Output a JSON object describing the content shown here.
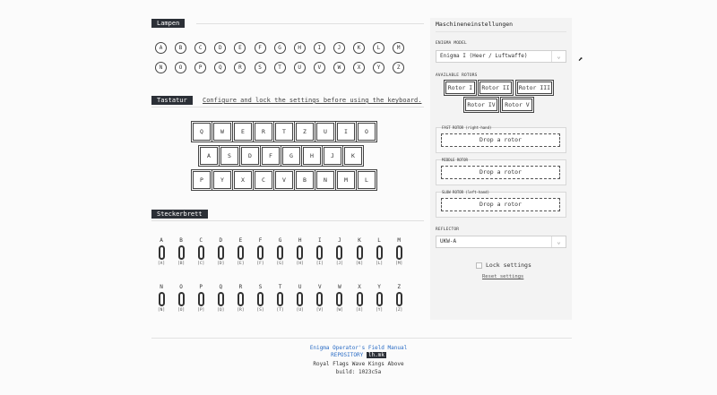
{
  "lampboard": {
    "title": "Lampen",
    "row1": [
      "A",
      "B",
      "C",
      "D",
      "E",
      "F",
      "G",
      "H",
      "I",
      "J",
      "K",
      "L",
      "M"
    ],
    "row2": [
      "N",
      "O",
      "P",
      "Q",
      "R",
      "S",
      "T",
      "U",
      "V",
      "W",
      "X",
      "Y",
      "Z"
    ]
  },
  "keyboard": {
    "title": "Tastatur",
    "note": "Configure and lock the settings before using the keyboard.",
    "row1": [
      "Q",
      "W",
      "E",
      "R",
      "T",
      "Z",
      "U",
      "I",
      "O"
    ],
    "row2": [
      "A",
      "S",
      "D",
      "F",
      "G",
      "H",
      "J",
      "K"
    ],
    "row3": [
      "P",
      "Y",
      "X",
      "C",
      "V",
      "B",
      "N",
      "M",
      "L"
    ]
  },
  "plugboard": {
    "title": "Steckerbrett",
    "row1": [
      "A",
      "B",
      "C",
      "D",
      "E",
      "F",
      "G",
      "H",
      "I",
      "J",
      "K",
      "L",
      "M"
    ],
    "row1_values": [
      "[A]",
      "[B]",
      "[C]",
      "[D]",
      "[E]",
      "[F]",
      "[G]",
      "[H]",
      "[I]",
      "[J]",
      "[K]",
      "[L]",
      "[M]"
    ],
    "row2": [
      "N",
      "O",
      "P",
      "Q",
      "R",
      "S",
      "T",
      "U",
      "V",
      "W",
      "X",
      "Y",
      "Z"
    ],
    "row2_values": [
      "[N]",
      "[O]",
      "[P]",
      "[Q]",
      "[R]",
      "[S]",
      "[T]",
      "[U]",
      "[V]",
      "[W]",
      "[X]",
      "[Y]",
      "[Z]"
    ]
  },
  "settings": {
    "title": "Maschineneinstellungen",
    "model_label": "ENIGMA MODEL",
    "model_value": "Enigma I (Heer / Luftwaffe)",
    "rotors_label": "AVAILABLE ROTORS",
    "rotors": [
      "Rotor I",
      "Rotor II",
      "Rotor III",
      "Rotor IV",
      "Rotor V"
    ],
    "fast_label": "FAST ROTOR (right-hand)",
    "middle_label": "MIDDLE ROTOR",
    "slow_label": "SLOW ROTOR (left-hand)",
    "drop_text": "Drop a rotor",
    "reflector_label": "REFLECTOR",
    "reflector_value": "UKW-A",
    "lock_label": "Lock settings",
    "reset_label": "Reset settings"
  },
  "footer": {
    "manual": "Enigma Operator's Field Manual",
    "repo_label": "REPOSITORY",
    "repo_badge": "lh.mk",
    "motto": "Royal Flags Wave Kings Above",
    "build": "build: 1023c5a"
  },
  "icons": {
    "chevron": "chevron-down-icon",
    "cursor": "mouse-cursor-icon"
  },
  "colors": {
    "accent_dark": "#2b2f36",
    "link": "#2a6cc5"
  }
}
